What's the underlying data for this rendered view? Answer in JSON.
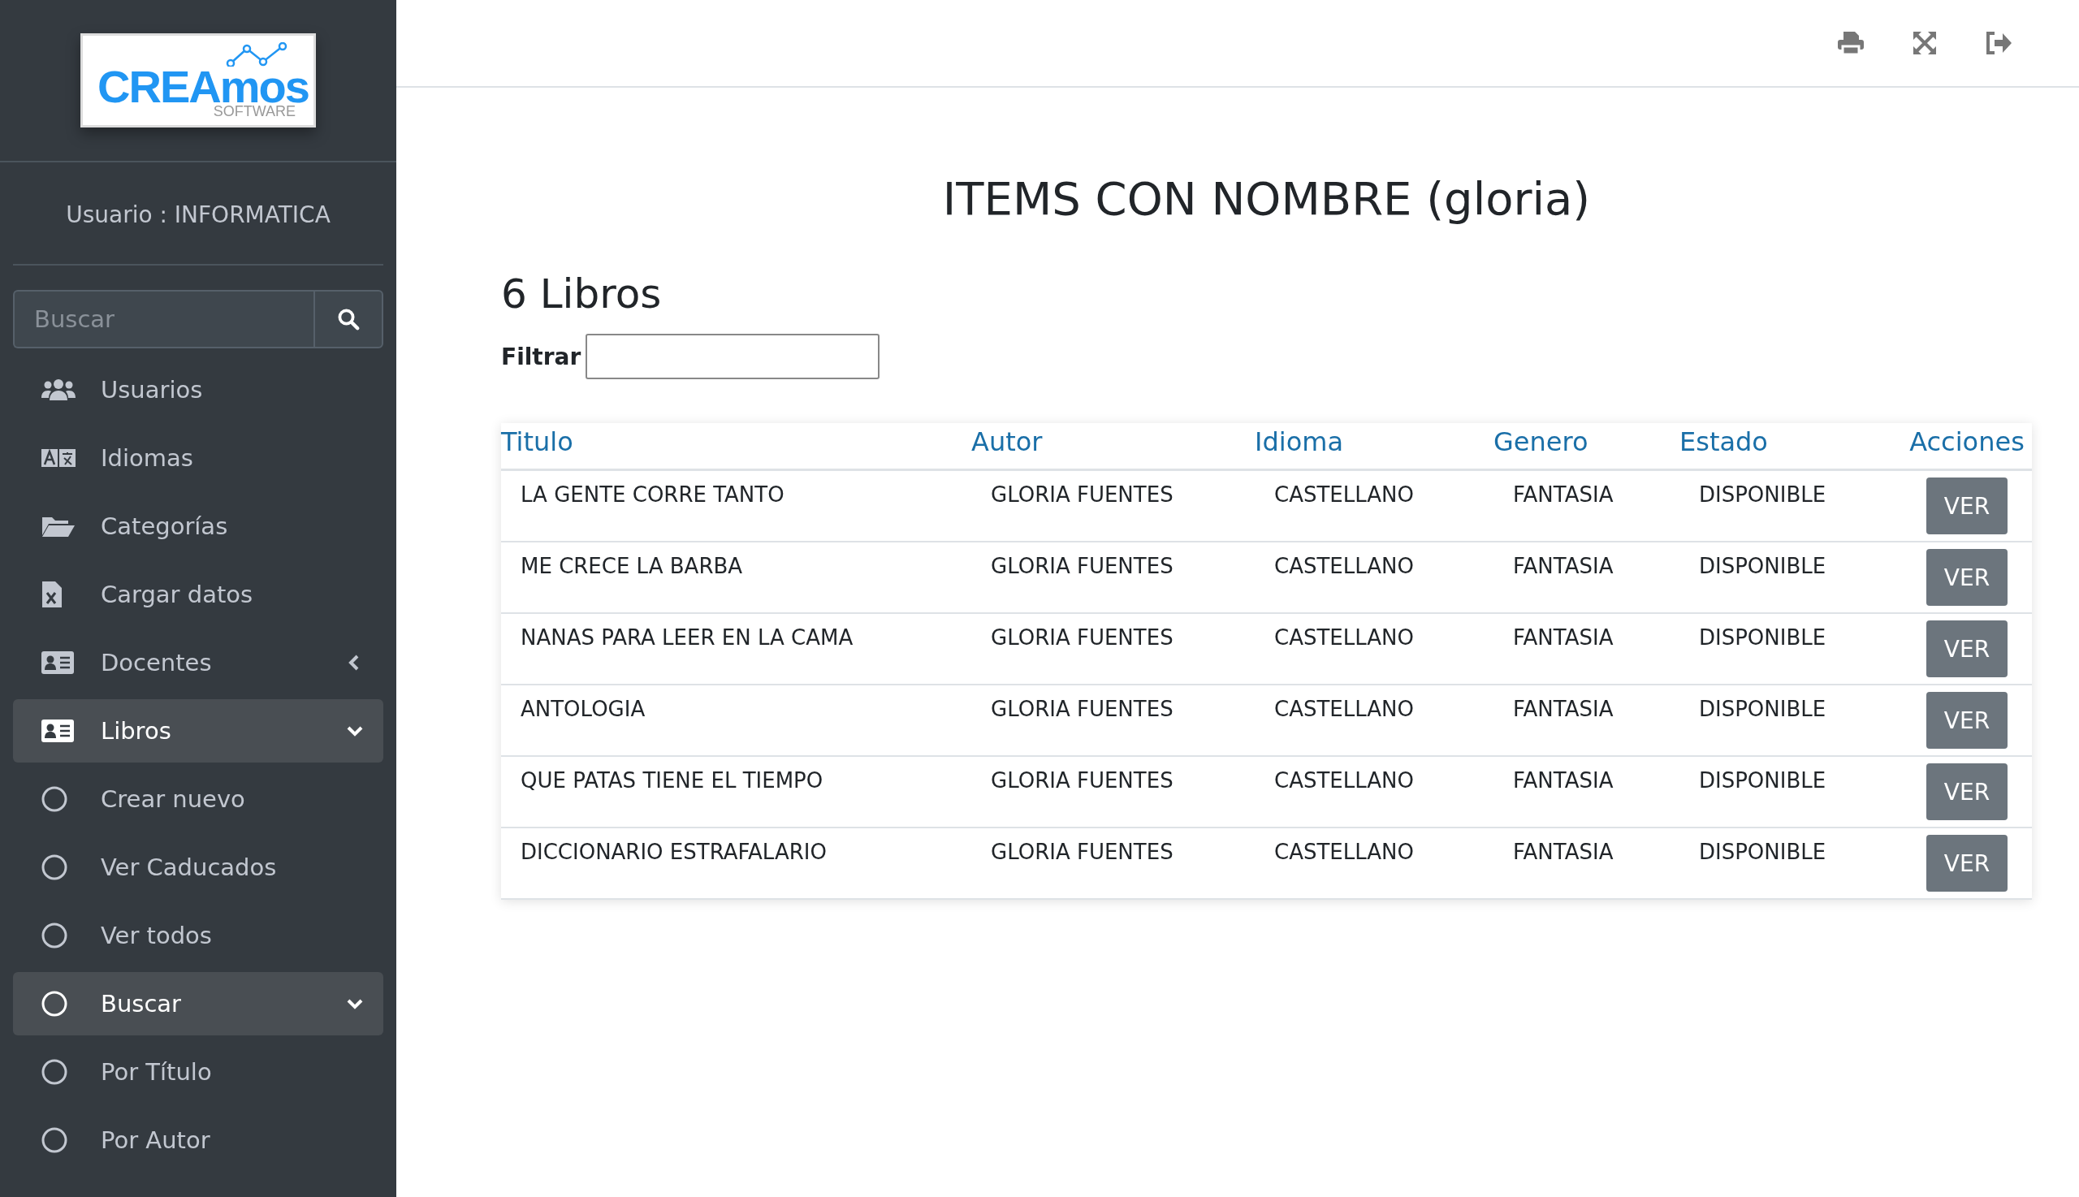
{
  "sidebar": {
    "logo": {
      "text": "CREAmos",
      "subtext": "SOFTWARE"
    },
    "user": "Usuario : INFORMATICA",
    "search": {
      "placeholder": "Buscar"
    },
    "items": [
      {
        "label": "Usuarios",
        "kind": "link",
        "selected": false
      },
      {
        "label": "Idiomas",
        "kind": "link",
        "selected": false
      },
      {
        "label": "Categorías",
        "kind": "link",
        "selected": false
      },
      {
        "label": "Cargar datos",
        "kind": "link",
        "selected": false
      },
      {
        "label": "Docentes",
        "kind": "group",
        "selected": false,
        "expanded": false
      },
      {
        "label": "Libros",
        "kind": "group",
        "selected": true,
        "expanded": true
      },
      {
        "label": "Crear nuevo",
        "kind": "sub",
        "selected": false
      },
      {
        "label": "Ver Caducados",
        "kind": "sub",
        "selected": false
      },
      {
        "label": "Ver todos",
        "kind": "sub",
        "selected": false
      },
      {
        "label": "Buscar",
        "kind": "subgroup",
        "selected": true,
        "expanded": true
      },
      {
        "label": "Por Título",
        "kind": "sub",
        "selected": false
      },
      {
        "label": "Por Autor",
        "kind": "sub",
        "selected": false
      }
    ]
  },
  "page": {
    "title": "ITEMS CON NOMBRE (gloria)",
    "count": "6 Libros",
    "filter": {
      "label": "Filtrar"
    }
  },
  "table": {
    "columns": [
      "Titulo",
      "Autor",
      "Idioma",
      "Genero",
      "Estado",
      "Acciones"
    ],
    "rows": [
      {
        "cells": [
          "LA GENTE CORRE TANTO",
          "GLORIA FUENTES",
          "CASTELLANO",
          "FANTASIA",
          "DISPONIBLE"
        ],
        "action": "VER"
      },
      {
        "cells": [
          "ME CRECE LA BARBA",
          "GLORIA FUENTES",
          "CASTELLANO",
          "FANTASIA",
          "DISPONIBLE"
        ],
        "action": "VER"
      },
      {
        "cells": [
          "NANAS PARA LEER EN LA CAMA",
          "GLORIA FUENTES",
          "CASTELLANO",
          "FANTASIA",
          "DISPONIBLE"
        ],
        "action": "VER"
      },
      {
        "cells": [
          "ANTOLOGIA",
          "GLORIA FUENTES",
          "CASTELLANO",
          "FANTASIA",
          "DISPONIBLE"
        ],
        "action": "VER"
      },
      {
        "cells": [
          "QUE PATAS TIENE EL TIEMPO",
          "GLORIA FUENTES",
          "CASTELLANO",
          "FANTASIA",
          "DISPONIBLE"
        ],
        "action": "VER"
      },
      {
        "cells": [
          "DICCIONARIO ESTRAFALARIO",
          "GLORIA FUENTES",
          "CASTELLANO",
          "FANTASIA",
          "DISPONIBLE"
        ],
        "action": "VER"
      }
    ]
  }
}
